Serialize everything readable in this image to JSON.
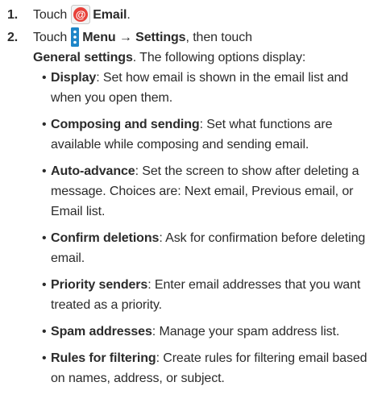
{
  "steps": [
    {
      "number": "1.",
      "prefix": "Touch",
      "icon": "email-app-icon",
      "app_name": "Email",
      "suffix": "."
    },
    {
      "number": "2.",
      "prefix": "Touch",
      "icon": "menu-icon",
      "menu_label": "Menu → Settings",
      "middle": ", then touch",
      "target": "General settings",
      "suffix": ". The following options display:"
    }
  ],
  "options": [
    {
      "term": "Display",
      "description": ": Set how email is shown in the email list and when you open them."
    },
    {
      "term": "Composing and sending",
      "description": ": Set what functions are available while composing and sending email."
    },
    {
      "term": "Auto-advance",
      "description": ": Set the screen to show after deleting a message. Choices are: Next email, Previous email, or Email list."
    },
    {
      "term": "Confirm deletions",
      "description": ": Ask for confirmation before deleting email."
    },
    {
      "term": "Priority senders",
      "description": ": Enter email addresses that you want treated as a priority."
    },
    {
      "term": "Spam addresses",
      "description": ": Manage your spam address list."
    },
    {
      "term": "Rules for filtering",
      "description": ": Create rules for filtering email based on names, address, or subject."
    }
  ],
  "colors": {
    "text": "#2b2b2b",
    "email_icon_bg": "#e8413a",
    "menu_icon_bg": "#1e86c8"
  }
}
